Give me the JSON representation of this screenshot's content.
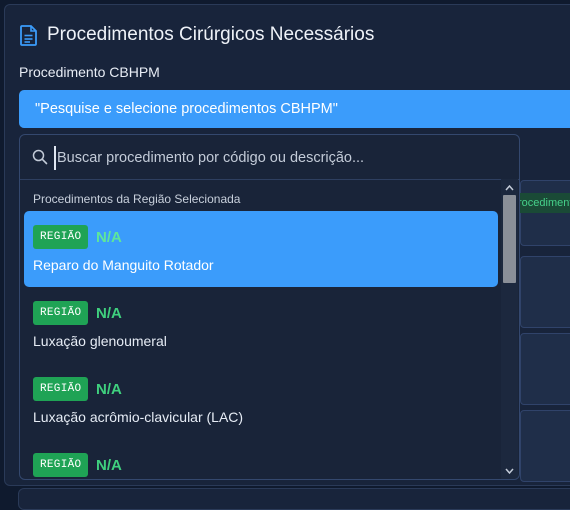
{
  "section": {
    "title": "Procedimentos Cirúrgicos Necessários",
    "icon": "document-icon"
  },
  "field": {
    "label": "Procedimento CBHPM",
    "selected_text": "\"Pesquise e selecione procedimentos CBHPM\""
  },
  "background": {
    "tag_text": "rocedimento"
  },
  "dropdown": {
    "search_placeholder": "Buscar procedimento por código ou descrição...",
    "search_value": "",
    "group_label": "Procedimentos da Região Selecionada",
    "items": [
      {
        "badge": "REGIÃO",
        "code": "N/A",
        "name": "Reparo do Manguito Rotador",
        "selected": true
      },
      {
        "badge": "REGIÃO",
        "code": "N/A",
        "name": "Luxação glenoumeral",
        "selected": false
      },
      {
        "badge": "REGIÃO",
        "code": "N/A",
        "name": "Luxação acrômio-clavicular (LAC)",
        "selected": false
      },
      {
        "badge": "REGIÃO",
        "code": "N/A",
        "name": "",
        "selected": false
      }
    ]
  },
  "colors": {
    "accent": "#3b9cfb",
    "badge": "#1fa355",
    "code_text": "#3fd07e",
    "panel": "#18243b"
  }
}
